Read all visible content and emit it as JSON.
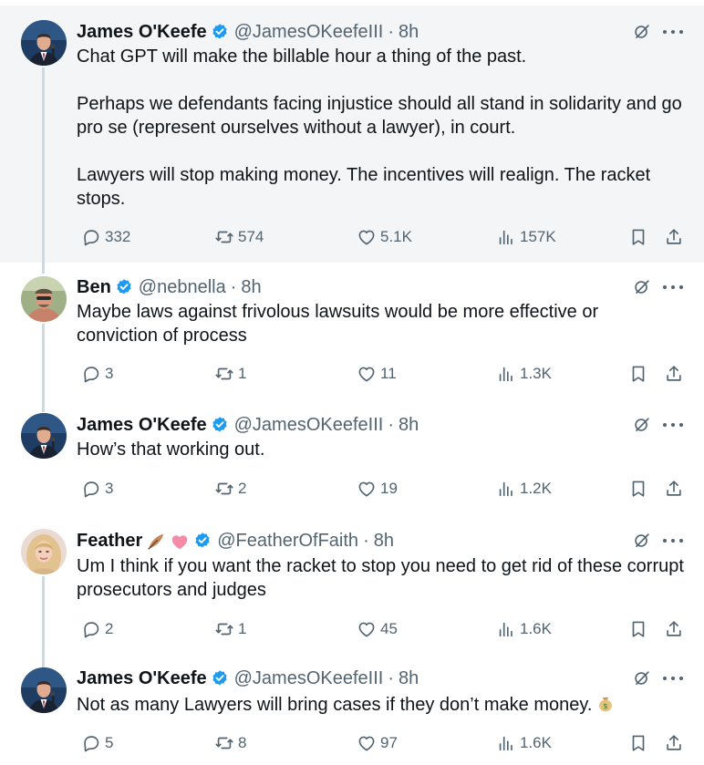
{
  "tweets": [
    {
      "name": "James O'Keefe",
      "handle": "@JamesOKeefeIII",
      "time": "8h",
      "lines": [
        "Chat GPT will make the billable hour a thing of the past.",
        "",
        "Perhaps we defendants facing injustice should all stand in solidarity and go",
        "pro se (represent ourselves without a lawyer), in court.",
        "",
        "Lawyers will stop making money. The incentives will realign. The racket",
        "stops."
      ],
      "replies": "332",
      "reposts": "574",
      "likes": "5.1K",
      "views": "157K",
      "highlighted": true
    },
    {
      "name": "Ben",
      "handle": "@nebnella",
      "time": "8h",
      "lines": [
        "Maybe laws against frivolous lawsuits would be more effective or",
        "conviction of process"
      ],
      "replies": "3",
      "reposts": "1",
      "likes": "11",
      "views": "1.3K"
    },
    {
      "name": "James O'Keefe",
      "handle": "@JamesOKeefeIII",
      "time": "8h",
      "lines": [
        "How’s that working out."
      ],
      "replies": "3",
      "reposts": "2",
      "likes": "19",
      "views": "1.2K"
    },
    {
      "name": "Feather",
      "name_emojis": [
        "feather-emoji",
        "pink-heart-emoji"
      ],
      "handle": "@FeatherOfFaith",
      "time": "8h",
      "lines": [
        "Um I think if you want the racket to stop you need to get rid of these corrupt",
        "prosecutors and judges"
      ],
      "replies": "2",
      "reposts": "1",
      "likes": "45",
      "views": "1.6K"
    },
    {
      "name": "James O'Keefe",
      "handle": "@JamesOKeefeIII",
      "time": "8h",
      "lines": [
        "Not as many Lawyers will bring cases if they don’t make money."
      ],
      "line_emoji": "money-bag-emoji",
      "replies": "5",
      "reposts": "8",
      "likes": "97",
      "views": "1.6K"
    }
  ],
  "colors": {
    "highlight_bg": "#f4f5f6",
    "verified": "#1d9bf0",
    "secondary_text": "#536471",
    "thread_line": "#cfd9de"
  },
  "icons": [
    "reply-icon",
    "repost-icon",
    "like-icon",
    "views-icon",
    "bookmark-icon",
    "share-icon",
    "grok-icon",
    "more-icon",
    "verified-badge-icon"
  ]
}
